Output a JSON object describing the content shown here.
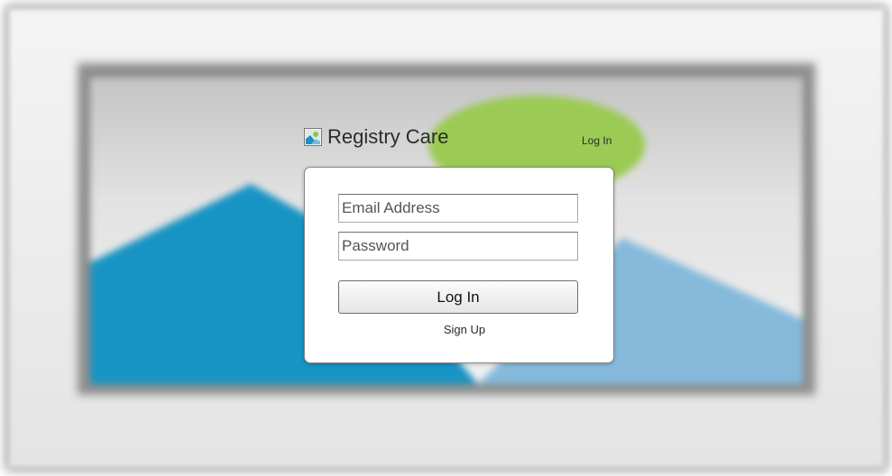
{
  "header": {
    "brand_name": "Registry Care",
    "brand_icon": "image-icon",
    "top_login_label": "Log In"
  },
  "login_form": {
    "email": {
      "placeholder": "Email Address",
      "value": ""
    },
    "password": {
      "placeholder": "Password",
      "value": ""
    },
    "submit_label": "Log In",
    "signup_label": "Sign Up"
  },
  "colors": {
    "background_blue": "#1894c4",
    "background_light_blue": "#85badb",
    "background_green": "#9bcb54",
    "panel_border": "#8a8a8a"
  }
}
